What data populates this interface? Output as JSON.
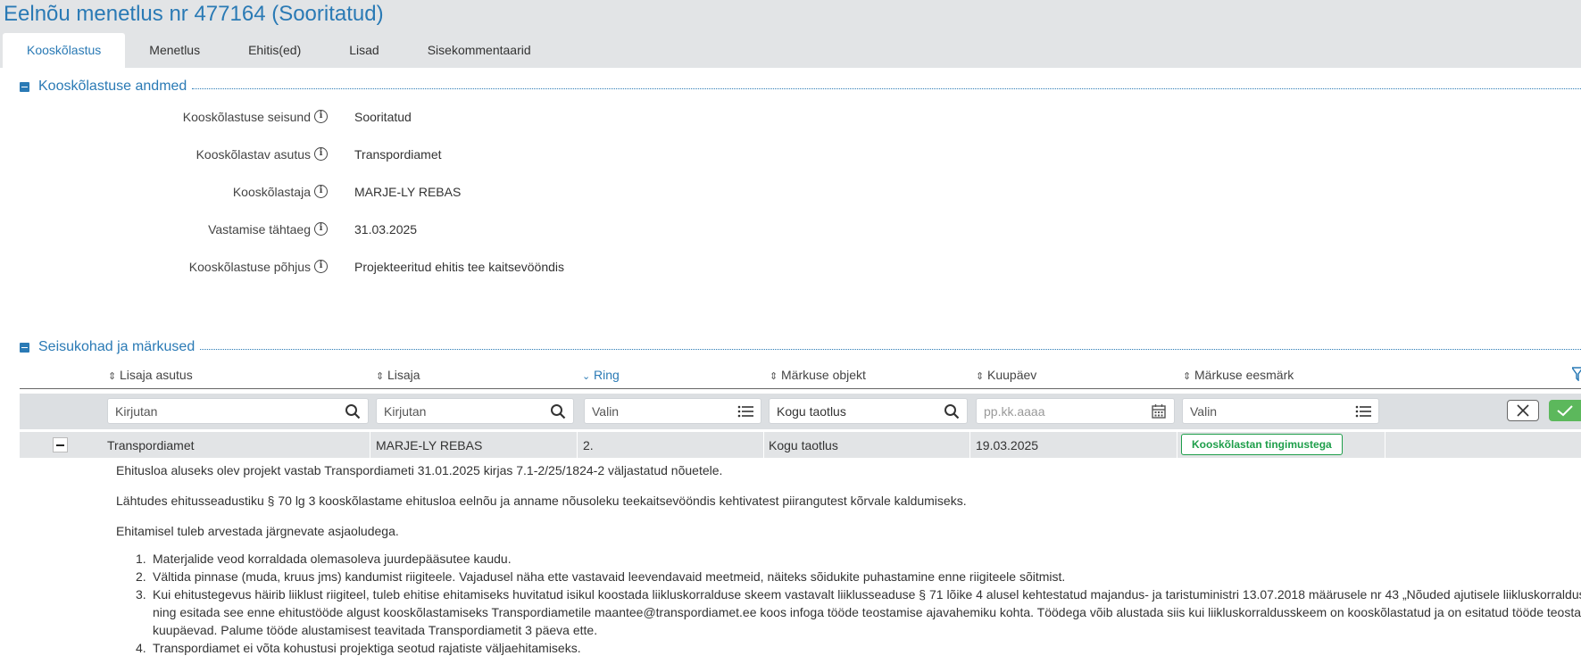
{
  "header": {
    "title": "Eelnõu menetlus nr 477164 (Sooritatud)",
    "tabs": [
      "Kooskõlastus",
      "Menetlus",
      "Ehitis(ed)",
      "Lisad",
      "Sisekommentaarid"
    ],
    "active_tab": "Kooskõlastus"
  },
  "section1": {
    "title": "Kooskõlastuse andmed",
    "fields": [
      {
        "label": "Kooskõlastuse seisund",
        "value": "Sooritatud"
      },
      {
        "label": "Kooskõlastav asutus",
        "value": "Transpordiamet"
      },
      {
        "label": "Kooskõlastaja",
        "value": "MARJE-LY REBAS"
      },
      {
        "label": "Vastamise tähtaeg",
        "value": "31.03.2025"
      },
      {
        "label": "Kooskõlastuse põhjus",
        "value": "Projekteeritud ehitis tee kaitsevööndis"
      }
    ]
  },
  "section2": {
    "title": "Seisukohad ja märkused",
    "columns": [
      "Lisaja asutus",
      "Lisaja",
      "Ring",
      "Märkuse objekt",
      "Kuupäev",
      "Märkuse eesmärk"
    ],
    "active_sort_column": "Ring",
    "filters": [
      {
        "placeholder": "Kirjutan",
        "icon": "search-icon"
      },
      {
        "placeholder": "Kirjutan",
        "icon": "search-icon"
      },
      {
        "placeholder": "Valin",
        "icon": "list-icon"
      },
      {
        "value": "Kogu taotlus",
        "icon": "search-icon"
      },
      {
        "placeholder": "pp.kk.aaaa",
        "icon": "calendar-icon"
      },
      {
        "placeholder": "Valin",
        "icon": "list-icon"
      }
    ],
    "row": {
      "asutus": "Transpordiamet",
      "lisaja": "MARJE-LY REBAS",
      "ring": "2.",
      "objekt": "Kogu taotlus",
      "kuupaev": "19.03.2025",
      "eesmark": "Kooskõlastan tingimustega"
    },
    "comment": {
      "paragraphs": [
        "Ehitusloa aluseks olev projekt vastab Transpordiameti 31.01.2025 kirjas 7.1-2/25/1824-2 väljastatud nõuetele.",
        "Lähtudes ehitusseadustiku § 70 lg 3 kooskõlastame ehitusloa eelnõu ja anname nõusoleku teekaitsevööndis kehtivatest piirangutest kõrvale kaldumiseks.",
        "Ehitamisel tuleb arvestada järgnevate asjaoludega."
      ],
      "list": [
        "Materjalide veod korraldada olemasoleva juurdepääsutee kaudu.",
        "Vältida pinnase (muda, kruus jms) kandumist riigiteele. Vajadusel näha ette vastavaid leevendavaid meetmeid, näiteks sõidukite puhastamine enne riigiteele sõitmist.",
        "Kui ehitustegevus häirib liiklust riigiteel, tuleb ehitise ehitamiseks huvitatud isikul koostada liikluskorralduse skeem vastavalt liiklusseaduse § 71 lõike 4 alusel kehtestatud majandus- ja taristuministri 13.07.2018 määrusele nr 43 „Nõuded ajutisele liikluskorraldusele“ ning esitada see enne ehitustööde algust kooskõlastamiseks Transpordiametile maantee@transpordiamet.ee koos infoga tööde teostamise ajavahemiku kohta. Töödega võib alustada siis kui liikluskorraldusskeem on kooskõlastatud ja on esitatud tööde teostamise kuupäevad. Palume tööde alustamisest teavitada Transpordiametit 3 päeva ette.",
        "Transpordiamet ei võta kohustusi projektiga seotud rajatiste väljaehitamiseks."
      ]
    }
  },
  "colors": {
    "accent": "#2a7ab5",
    "success": "#1e9e4a",
    "header_bg": "#e2e4e6"
  }
}
